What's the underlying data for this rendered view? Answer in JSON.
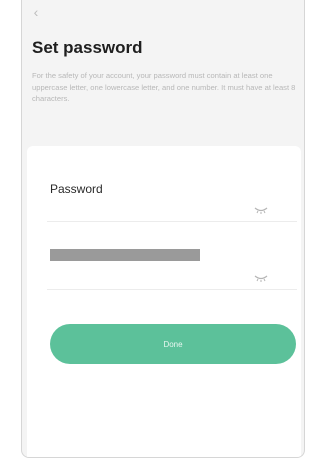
{
  "header": {
    "back_icon": "chevron-left-icon",
    "title": "Set password",
    "description": "For the safety of your account, your password must contain at least one uppercase letter, one lowercase letter, and one number. It must have at least 8 characters."
  },
  "form": {
    "password_label": "Password",
    "eye_icon": "eye-closed-icon",
    "done_label": "Done"
  },
  "colors": {
    "accent": "#5cc19a",
    "background": "#f4f4f4"
  }
}
